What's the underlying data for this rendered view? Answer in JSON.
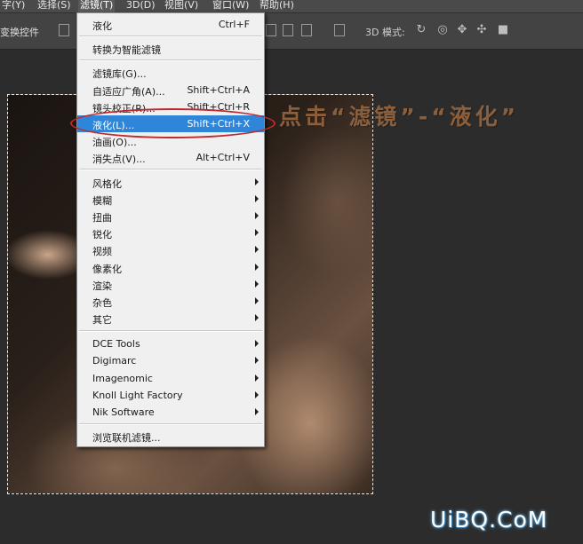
{
  "menubar": {
    "items": [
      "字(Y)",
      "选择(S)",
      "滤镜(T)",
      "3D(D)",
      "视图(V)",
      "窗口(W)",
      "帮助(H)"
    ]
  },
  "optbar": {
    "label": "变换控件",
    "mode_label": "3D 模式:"
  },
  "menu": {
    "last_filter": {
      "label": "液化",
      "shortcut": "Ctrl+F"
    },
    "convert_smart": "转换为智能滤镜",
    "gallery": "滤镜库(G)...",
    "adaptive_wide": {
      "label": "自适应广角(A)...",
      "shortcut": "Shift+Ctrl+A"
    },
    "lens_correction": {
      "label": "镜头校正(R)...",
      "shortcut": "Shift+Ctrl+R"
    },
    "liquify": {
      "label": "液化(L)...",
      "shortcut": "Shift+Ctrl+X"
    },
    "oil_paint": "油画(O)...",
    "vanishing_point": {
      "label": "消失点(V)...",
      "shortcut": "Alt+Ctrl+V"
    },
    "stylize": "风格化",
    "blur": "模糊",
    "distort": "扭曲",
    "sharpen": "锐化",
    "video": "视频",
    "pixelate": "像素化",
    "render": "渲染",
    "noise": "杂色",
    "other": "其它",
    "dce": "DCE Tools",
    "digimarc": "Digimarc",
    "imagenomic": "Imagenomic",
    "knoll": "Knoll Light Factory",
    "nik": "Nik Software",
    "browse_online": "浏览联机滤镜..."
  },
  "annotation": "点击“滤镜”-“液化”",
  "watermark": "UiBQ.CoM",
  "colors": {
    "highlight": "#2f86d8",
    "annotation": "#8b5f3c",
    "oval": "#c0282c"
  }
}
